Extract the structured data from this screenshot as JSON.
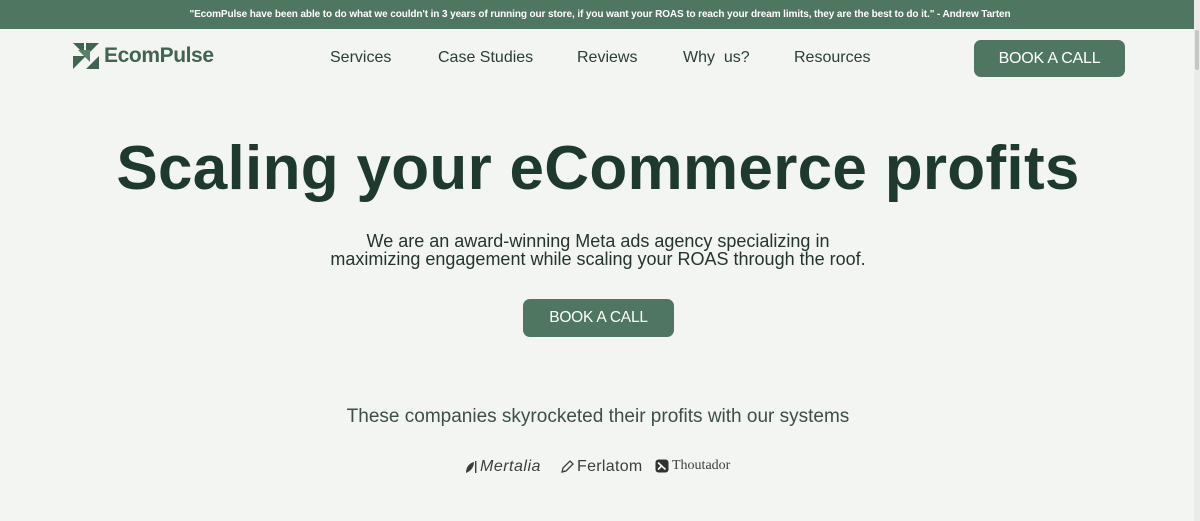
{
  "announcement": {
    "text": "\"EcomPulse have been able to do what we couldn't in 3 years of running our store, if you want your ROAS to reach your dream limits, they are the best to do it.\" - Andrew Tarten"
  },
  "header": {
    "logo_text": "EcomPulse",
    "nav": [
      {
        "label": "Services"
      },
      {
        "label": "Case Studies"
      },
      {
        "label": "Reviews"
      },
      {
        "label": "Why  us?"
      },
      {
        "label": "Resources"
      }
    ],
    "cta_label": "BOOK A CALL"
  },
  "hero": {
    "headline": "Scaling your eCommerce profits",
    "sub_line1": "We are an award-winning Meta ads agency specializing in",
    "sub_line2": "maximizing engagement while scaling your ROAS through the roof.",
    "cta_label": "BOOK A CALL"
  },
  "companies": {
    "title": "These companies skyrocketed their profits with our systems",
    "brands": [
      {
        "name": "Mertalia",
        "icon": "leaf-icon"
      },
      {
        "name": "Ferlatom",
        "icon": "pen-icon"
      },
      {
        "name": "Thoutador",
        "icon": "badge-icon"
      }
    ]
  },
  "colors": {
    "accent": "#4f7660",
    "background": "#f2f5f1",
    "headline": "#1e3a2f"
  }
}
